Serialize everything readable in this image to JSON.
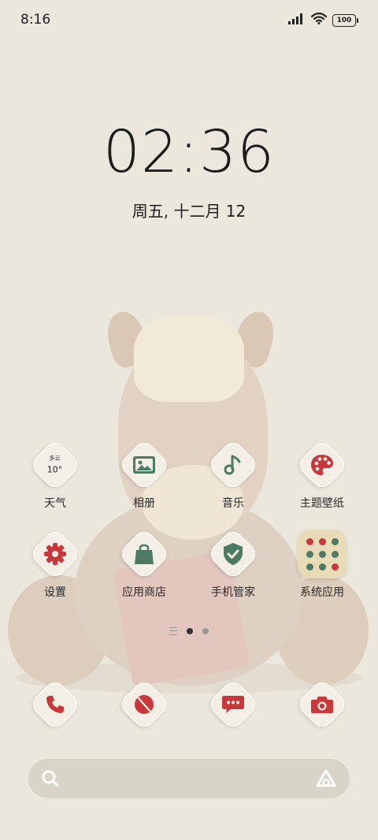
{
  "status_bar": {
    "time": "8:16",
    "battery": "100"
  },
  "lockclock": {
    "time": "02:36",
    "date": "周五, 十二月 12"
  },
  "apps": {
    "weather": {
      "label": "天气",
      "desc": "多云",
      "temp": "10°"
    },
    "album": {
      "label": "相册"
    },
    "music": {
      "label": "音乐"
    },
    "themes": {
      "label": "主题壁纸"
    },
    "settings": {
      "label": "设置"
    },
    "appstore": {
      "label": "应用商店"
    },
    "security": {
      "label": "手机管家"
    },
    "system_folder": {
      "label": "系统应用"
    }
  },
  "dock": [
    "phone-icon",
    "browser-icon",
    "messages-icon",
    "camera-icon"
  ],
  "pager": {
    "pages": 2,
    "active": 1
  },
  "colors": {
    "accent_red": "#c8383a",
    "icon_green": "#4c7a62",
    "background": "#ebe7dc"
  }
}
